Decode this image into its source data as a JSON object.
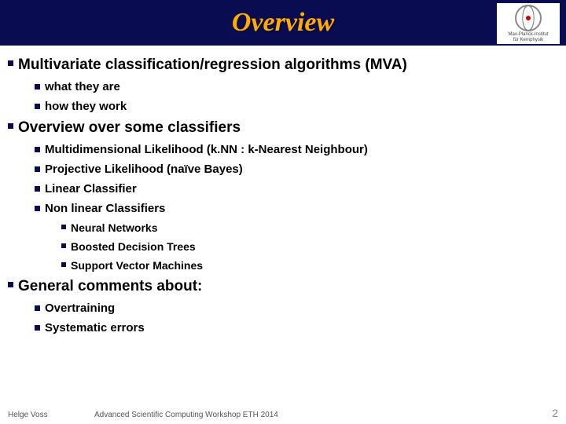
{
  "title": "Overview",
  "logo": {
    "line1": "Max-Planck-Institut",
    "line2": "für Kernphysik"
  },
  "items": [
    {
      "level": 0,
      "text": "Multivariate  classification/regression  algorithms  (MVA)"
    },
    {
      "level": 1,
      "text": "what they are"
    },
    {
      "level": 1,
      "text": "how they work"
    },
    {
      "level": 0,
      "text": "Overview over some classifiers"
    },
    {
      "level": 1,
      "text": "Multidimensional Likelihood  (k.NN : k-Nearest Neighbour)"
    },
    {
      "level": 1,
      "text": "Projective Likelihood (naïve Bayes)"
    },
    {
      "level": 1,
      "text": "Linear Classifier"
    },
    {
      "level": 1,
      "text": "Non linear Classifiers"
    },
    {
      "level": 2,
      "text": "Neural Networks"
    },
    {
      "level": 2,
      "text": "Boosted Decision Trees"
    },
    {
      "level": 2,
      "text": "Support Vector Machines"
    },
    {
      "level": 0,
      "text": "General comments about:"
    },
    {
      "level": 1,
      "text": "Overtraining"
    },
    {
      "level": 1,
      "text": "Systematic errors"
    }
  ],
  "footer": {
    "author": "Helge Voss",
    "center": "Advanced Scientific Computing Workshop ETH 2014",
    "page": "2"
  }
}
